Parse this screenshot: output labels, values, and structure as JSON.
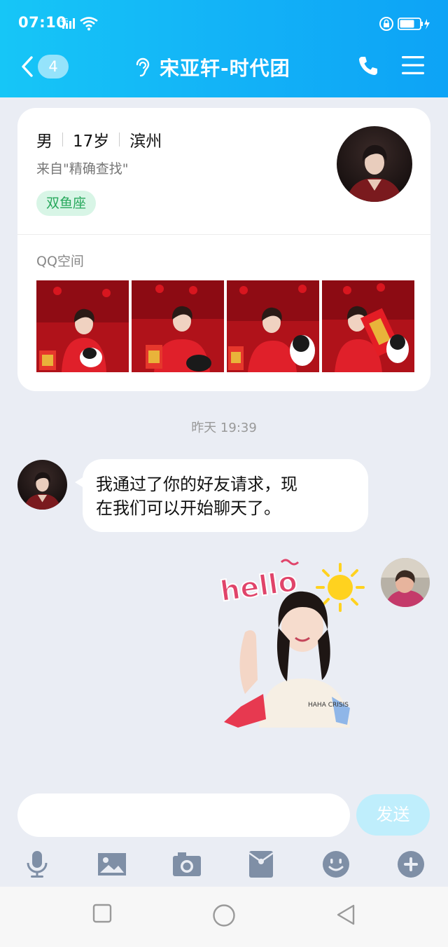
{
  "status_bar": {
    "time": "07:10",
    "network": "4G"
  },
  "nav": {
    "unread_count": "4",
    "title": "宋亚轩-时代团"
  },
  "profile": {
    "gender": "男",
    "age": "17岁",
    "city": "滨州",
    "source": "来自\"精确查找\"",
    "zodiac": "双鱼座",
    "qzone_label": "QQ空间"
  },
  "messages": {
    "timestamp": "昨天 19:39",
    "incoming_line1": "我通过了你的好友请求，现",
    "incoming_line2": "在我们可以开始聊天了。",
    "sticker_text": "hello"
  },
  "input": {
    "placeholder": "",
    "send_label": "发送"
  },
  "toolbar_icons": [
    "microphone-icon",
    "image-icon",
    "camera-icon",
    "red-packet-icon",
    "emoji-icon",
    "plus-icon"
  ],
  "colors": {
    "header_start": "#16c6f7",
    "header_end": "#0da3f6",
    "background": "#eaedf4",
    "toolbar_icon": "#7f8fa6",
    "send_button": "#bfeefc"
  }
}
